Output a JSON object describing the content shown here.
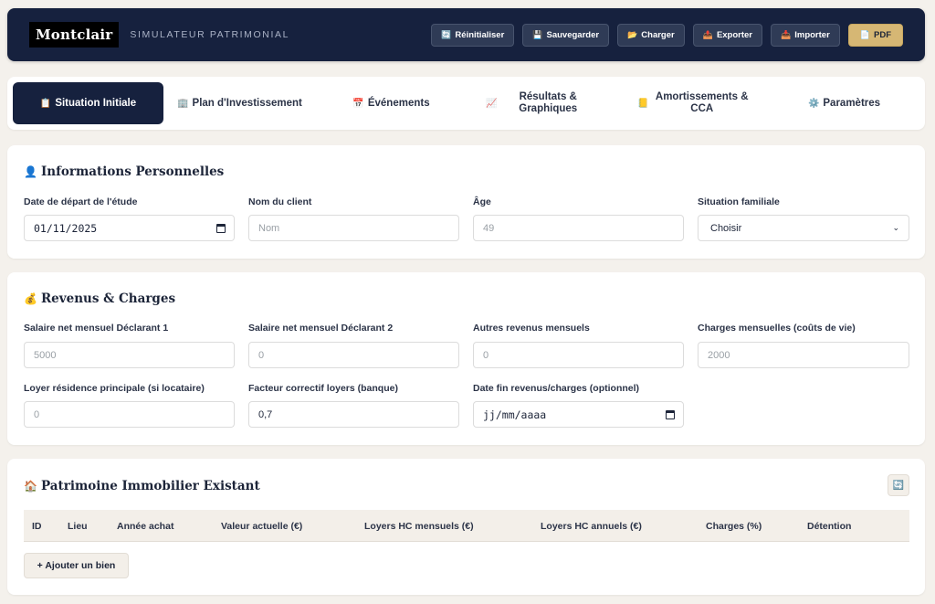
{
  "header": {
    "logo": "Montclair",
    "subtitle": "SIMULATEUR PATRIMONIAL",
    "actions": [
      {
        "icon": "🔄",
        "label": "Réinitialiser"
      },
      {
        "icon": "💾",
        "label": "Sauvegarder"
      },
      {
        "icon": "📂",
        "label": "Charger"
      },
      {
        "icon": "📤",
        "label": "Exporter"
      },
      {
        "icon": "📥",
        "label": "Importer"
      },
      {
        "icon": "📄",
        "label": "PDF"
      }
    ]
  },
  "tabs": [
    {
      "icon": "📋",
      "label": "Situation Initiale"
    },
    {
      "icon": "🏢",
      "label": "Plan d'Investissement"
    },
    {
      "icon": "📅",
      "label": "Événements"
    },
    {
      "icon": "📈",
      "label": "Résultats & Graphiques"
    },
    {
      "icon": "📒",
      "label": "Amortissements & CCA"
    },
    {
      "icon": "⚙️",
      "label": "Paramètres"
    }
  ],
  "personal": {
    "icon": "👤",
    "title": "Informations Personnelles",
    "start_date_label": "Date de départ de l'étude",
    "start_date_value": "01/11/2025",
    "client_name_label": "Nom du client",
    "client_name_placeholder": "Nom",
    "age_label": "Âge",
    "age_value": "49",
    "family_label": "Situation familiale",
    "family_value": "Choisir"
  },
  "income": {
    "icon": "💰",
    "title": "Revenus & Charges",
    "salary1_label": "Salaire net mensuel Déclarant 1",
    "salary1_value": "5000",
    "salary2_label": "Salaire net mensuel Déclarant 2",
    "salary2_value": "0",
    "other_label": "Autres revenus mensuels",
    "other_value": "0",
    "charges_label": "Charges mensuelles (coûts de vie)",
    "charges_value": "2000",
    "rent_label": "Loyer résidence principale (si locataire)",
    "rent_value": "0",
    "factor_label": "Facteur correctif loyers (banque)",
    "factor_value": "0,7",
    "end_date_label": "Date fin revenus/charges (optionnel)",
    "end_date_value": "jj/mm/aaaa"
  },
  "realestate": {
    "icon": "🏠",
    "title": "Patrimoine Immobilier Existant",
    "columns": [
      "ID",
      "Lieu",
      "Année achat",
      "Valeur actuelle (€)",
      "Loyers HC mensuels (€)",
      "Loyers HC annuels (€)",
      "Charges (%)",
      "Détention"
    ],
    "add_label": "+ Ajouter un bien",
    "refresh_icon": "🔄"
  }
}
